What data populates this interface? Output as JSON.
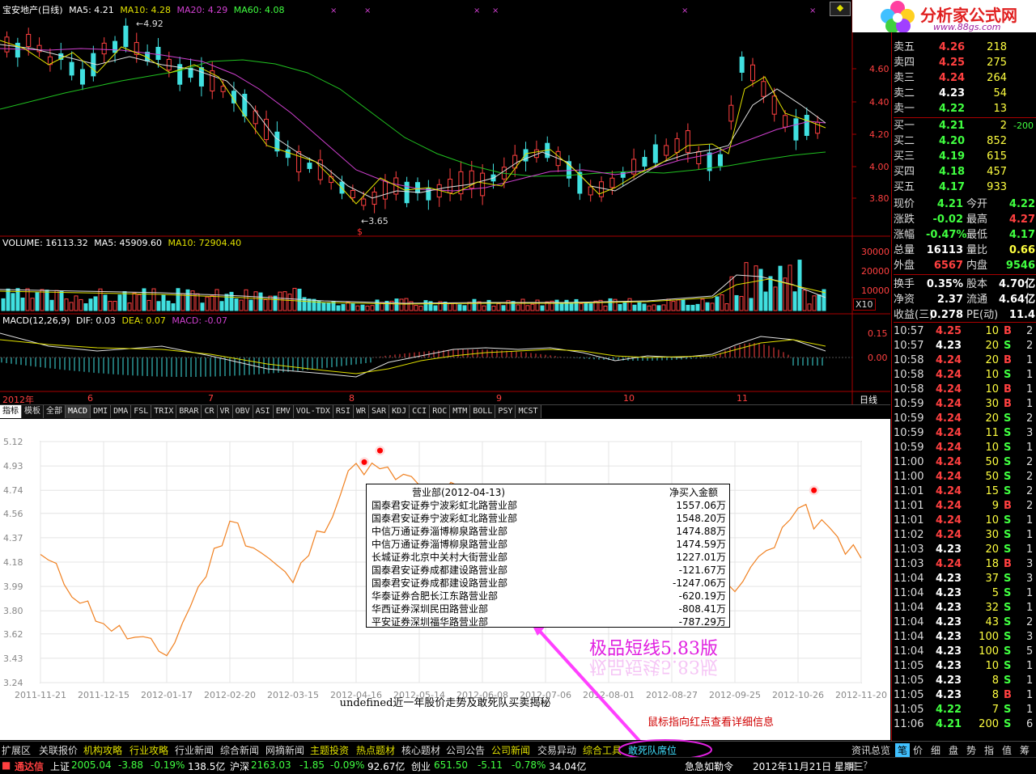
{
  "header": {
    "stock": "宝安地产(日线)",
    "ma5": "MA5: 4.21",
    "ma10": "MA10: 4.28",
    "ma20": "MA20: 4.29",
    "ma60": "MA60: 4.08",
    "high_mark": "4.92",
    "low_mark": "3.65"
  },
  "price_axis": [
    "4.60",
    "4.40",
    "4.20",
    "4.00",
    "3.80"
  ],
  "volume": {
    "label": "VOLUME: 16113.32",
    "ma5": "MA5: 45909.60",
    "ma10": "MA10: 72904.40",
    "axis": [
      "30000",
      "20000",
      "10000"
    ],
    "unit": "X10"
  },
  "macd": {
    "label": "MACD(12,26,9)",
    "dif": "DIF: 0.03",
    "dea": "DEA: 0.07",
    "macd": "MACD: -0.07",
    "axis": [
      "0.15",
      "0.00"
    ]
  },
  "date_axis": {
    "labels": [
      "2012年",
      "6",
      "7",
      "8",
      "9",
      "10",
      "11"
    ],
    "period": "日线"
  },
  "indicator_tabs": [
    "指标",
    "模板",
    "全部",
    "MACD",
    "DMI",
    "DMA",
    "FSL",
    "TRIX",
    "BRAR",
    "CR",
    "VR",
    "OBV",
    "ASI",
    "EMV",
    "VOL-TDX",
    "RSI",
    "WR",
    "SAR",
    "KDJ",
    "CCI",
    "ROC",
    "MTM",
    "BOLL",
    "PSY",
    "MCST"
  ],
  "lower_chart": {
    "footer_title": "undefined近一年股价走势及敢死队买卖揭秘",
    "hint": "鼠标指向红点查看详细信息",
    "brand": "极品短线5.83版",
    "y_ticks": [
      "5.12",
      "4.93",
      "4.74",
      "4.56",
      "4.37",
      "4.18",
      "3.99",
      "3.80",
      "3.62",
      "3.43",
      "3.24"
    ],
    "x_ticks": [
      "2011-11-21",
      "2011-12-15",
      "2012-01-17",
      "2012-02-20",
      "2012-03-15",
      "2012-04-16",
      "2012-05-14",
      "2012-06-08",
      "2012-07-06",
      "2012-08-01",
      "2012-08-27",
      "2012-09-25",
      "2012-10-26",
      "2012-11-20"
    ],
    "popup": {
      "header_name": "营业部(2012-04-13)",
      "header_value": "净买入金额",
      "rows": [
        {
          "name": "国泰君安证券宁波彩虹北路营业部",
          "value": "1557.06万"
        },
        {
          "name": "国泰君安证券宁波彩虹北路营业部",
          "value": "1548.20万"
        },
        {
          "name": "中信万通证券淄博柳泉路营业部",
          "value": "1474.88万"
        },
        {
          "name": "中信万通证券淄博柳泉路营业部",
          "value": "1474.59万"
        },
        {
          "name": "长城证券北京中关村大街营业部",
          "value": "1227.01万"
        },
        {
          "name": "国泰君安证券成都建设路营业部",
          "value": "-121.67万"
        },
        {
          "name": "国泰君安证券成都建设路营业部",
          "value": "-1247.06万"
        },
        {
          "name": "华泰证券合肥长江东路营业部",
          "value": "-620.19万"
        },
        {
          "name": "华西证券深圳民田路营业部",
          "value": "-808.41万"
        },
        {
          "name": "平安证券深圳福华路营业部",
          "value": "-787.29万"
        }
      ]
    }
  },
  "chart_data": {
    "type": "line",
    "title": "undefined近一年股价走势及敢死队买卖揭秘",
    "xlabel": "",
    "ylabel": "",
    "ylim": [
      3.24,
      5.12
    ],
    "x": [
      "2011-11-21",
      "2011-12-15",
      "2012-01-17",
      "2012-02-20",
      "2012-03-15",
      "2012-04-16",
      "2012-05-14",
      "2012-06-08",
      "2012-07-06",
      "2012-08-01",
      "2012-08-27",
      "2012-09-25",
      "2012-10-26",
      "2012-11-20"
    ],
    "series": [
      {
        "values": [
          4.24,
          3.7,
          3.45,
          4.5,
          4.02,
          4.95,
          4.78,
          4.7,
          4.3,
          3.95,
          3.85,
          3.95,
          4.6,
          4.21
        ]
      }
    ],
    "markers": [
      {
        "x": "2012-04-13",
        "y": 4.96
      },
      {
        "x": "2012-04-20",
        "y": 5.05
      },
      {
        "x": "2012-10-30",
        "y": 4.74
      }
    ],
    "grid": true
  },
  "logo": {
    "title": "分析家公式网",
    "url_text": "www.88gs.com"
  },
  "order_book": [
    {
      "label": "卖五",
      "price": "4.26",
      "vol": "218",
      "color": "#ff4040"
    },
    {
      "label": "卖四",
      "price": "4.25",
      "vol": "275",
      "color": "#ff4040"
    },
    {
      "label": "卖三",
      "price": "4.24",
      "vol": "264",
      "color": "#ff4040"
    },
    {
      "label": "卖二",
      "price": "4.23",
      "vol": "54",
      "color": "#ffffff"
    },
    {
      "label": "卖一",
      "price": "4.22",
      "vol": "13",
      "color": "#40ff40"
    },
    {
      "label": "买一",
      "price": "4.21",
      "vol": "2",
      "extra": "-200",
      "color": "#40ff40"
    },
    {
      "label": "买二",
      "price": "4.20",
      "vol": "852",
      "color": "#40ff40"
    },
    {
      "label": "买三",
      "price": "4.19",
      "vol": "615",
      "color": "#40ff40"
    },
    {
      "label": "买四",
      "price": "4.18",
      "vol": "457",
      "color": "#40ff40"
    },
    {
      "label": "买五",
      "price": "4.17",
      "vol": "933",
      "color": "#40ff40"
    }
  ],
  "stats": [
    {
      "l1": "现价",
      "v1": "4.21",
      "c1": "#40ff40",
      "l2": "今开",
      "v2": "4.22",
      "c2": "#40ff40"
    },
    {
      "l1": "涨跌",
      "v1": "-0.02",
      "c1": "#40ff40",
      "l2": "最高",
      "v2": "4.27",
      "c2": "#ff4040"
    },
    {
      "l1": "涨幅",
      "v1": "-0.47%",
      "c1": "#40ff40",
      "l2": "最低",
      "v2": "4.17",
      "c2": "#40ff40"
    },
    {
      "l1": "总量",
      "v1": "16113",
      "c1": "#ffffff",
      "l2": "量比",
      "v2": "0.66",
      "c2": "#ffff40"
    },
    {
      "l1": "外盘",
      "v1": "6567",
      "c1": "#ff4040",
      "l2": "内盘",
      "v2": "9546",
      "c2": "#40ff40"
    },
    {
      "l1": "换手",
      "v1": "0.35%",
      "c1": "#ffffff",
      "l2": "股本",
      "v2": "4.70亿",
      "c2": "#ffffff"
    },
    {
      "l1": "净资",
      "v1": "2.37",
      "c1": "#ffffff",
      "l2": "流通",
      "v2": "4.64亿",
      "c2": "#ffffff"
    },
    {
      "l1": "收益(三)",
      "v1": "0.278",
      "c1": "#ffffff",
      "l2": "PE(动)",
      "v2": "11.4",
      "c2": "#ffffff"
    }
  ],
  "ticks": [
    {
      "t": "10:57",
      "p": "4.25",
      "v": "10",
      "s": "B",
      "n": "2",
      "pc": "#ff4040"
    },
    {
      "t": "10:57",
      "p": "4.23",
      "v": "20",
      "s": "S",
      "n": "2",
      "pc": "#ffffff"
    },
    {
      "t": "10:58",
      "p": "4.24",
      "v": "20",
      "s": "B",
      "n": "1",
      "pc": "#ff4040"
    },
    {
      "t": "10:58",
      "p": "4.24",
      "v": "10",
      "s": "S",
      "n": "1",
      "pc": "#ff4040"
    },
    {
      "t": "10:58",
      "p": "4.24",
      "v": "10",
      "s": "B",
      "n": "1",
      "pc": "#ff4040"
    },
    {
      "t": "10:59",
      "p": "4.24",
      "v": "30",
      "s": "B",
      "n": "1",
      "pc": "#ff4040"
    },
    {
      "t": "10:59",
      "p": "4.24",
      "v": "20",
      "s": "S",
      "n": "2",
      "pc": "#ff4040"
    },
    {
      "t": "10:59",
      "p": "4.24",
      "v": "11",
      "s": "S",
      "n": "3",
      "pc": "#ff4040"
    },
    {
      "t": "10:59",
      "p": "4.24",
      "v": "10",
      "s": "S",
      "n": "1",
      "pc": "#ff4040"
    },
    {
      "t": "11:00",
      "p": "4.24",
      "v": "50",
      "s": "S",
      "n": "2",
      "pc": "#ff4040"
    },
    {
      "t": "11:00",
      "p": "4.24",
      "v": "50",
      "s": "S",
      "n": "2",
      "pc": "#ff4040"
    },
    {
      "t": "11:01",
      "p": "4.24",
      "v": "15",
      "s": "S",
      "n": "2",
      "pc": "#ff4040"
    },
    {
      "t": "11:01",
      "p": "4.24",
      "v": "9",
      "s": "B",
      "n": "2",
      "pc": "#ff4040"
    },
    {
      "t": "11:01",
      "p": "4.24",
      "v": "10",
      "s": "S",
      "n": "1",
      "pc": "#ff4040"
    },
    {
      "t": "11:02",
      "p": "4.24",
      "v": "30",
      "s": "S",
      "n": "1",
      "pc": "#ff4040"
    },
    {
      "t": "11:03",
      "p": "4.23",
      "v": "20",
      "s": "S",
      "n": "1",
      "pc": "#ffffff"
    },
    {
      "t": "11:03",
      "p": "4.24",
      "v": "18",
      "s": "B",
      "n": "3",
      "pc": "#ff4040"
    },
    {
      "t": "11:04",
      "p": "4.23",
      "v": "37",
      "s": "S",
      "n": "3",
      "pc": "#ffffff"
    },
    {
      "t": "11:04",
      "p": "4.23",
      "v": "5",
      "s": "S",
      "n": "1",
      "pc": "#ffffff"
    },
    {
      "t": "11:04",
      "p": "4.23",
      "v": "32",
      "s": "S",
      "n": "1",
      "pc": "#ffffff"
    },
    {
      "t": "11:04",
      "p": "4.23",
      "v": "43",
      "s": "S",
      "n": "2",
      "pc": "#ffffff"
    },
    {
      "t": "11:04",
      "p": "4.23",
      "v": "100",
      "s": "S",
      "n": "3",
      "pc": "#ffffff"
    },
    {
      "t": "11:04",
      "p": "4.23",
      "v": "100",
      "s": "S",
      "n": "5",
      "pc": "#ffffff"
    },
    {
      "t": "11:05",
      "p": "4.23",
      "v": "10",
      "s": "S",
      "n": "1",
      "pc": "#ffffff"
    },
    {
      "t": "11:05",
      "p": "4.23",
      "v": "8",
      "s": "S",
      "n": "1",
      "pc": "#ffffff"
    },
    {
      "t": "11:05",
      "p": "4.23",
      "v": "8",
      "s": "B",
      "n": "1",
      "pc": "#ffffff"
    },
    {
      "t": "11:05",
      "p": "4.22",
      "v": "7",
      "s": "S",
      "n": "1",
      "pc": "#40ff40"
    },
    {
      "t": "11:06",
      "p": "4.21",
      "v": "200",
      "s": "S",
      "n": "6",
      "pc": "#40ff40"
    }
  ],
  "bottom_tabs": [
    "扩展区",
    "关联报价",
    "机构攻略",
    "行业攻略",
    "行业新闻",
    "综合新闻",
    "网摘新闻",
    "主题投资",
    "热点题材",
    "核心题材",
    "公司公告",
    "公司新闻",
    "交易异动",
    "综合工具",
    "敢死队席位"
  ],
  "bottom_right_tabs": [
    "资讯总览",
    "笔",
    "价",
    "细",
    "盘",
    "势",
    "指",
    "值",
    "筹"
  ],
  "status": {
    "app": "通达信",
    "sh_label": "上证",
    "sh_val": "2005.04",
    "sh_chg": "-3.88",
    "sh_pct": "-0.19%",
    "sh_amt": "138.5亿",
    "hs_label": "沪深",
    "hs_val": "2163.03",
    "hs_chg": "-1.85",
    "hs_pct": "-0.09%",
    "hs_amt": "92.67亿",
    "cy_label": "创业",
    "cy_val": "651.50",
    "cy_chg": "-5.11",
    "cy_pct": "-0.78%",
    "cy_amt": "34.04亿",
    "notice": "急急如勒令",
    "date": "2012年11月21日 星期三"
  }
}
